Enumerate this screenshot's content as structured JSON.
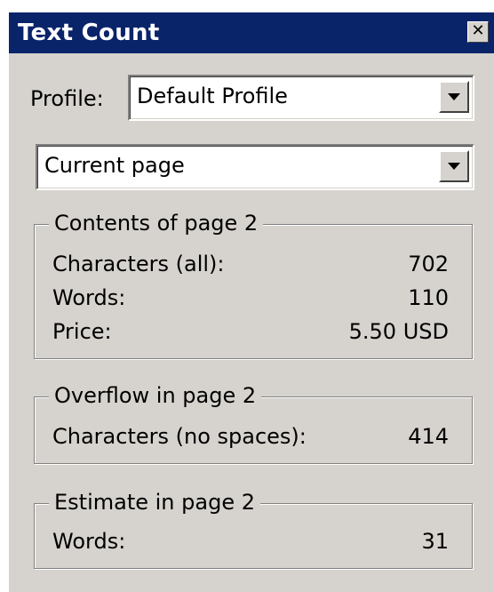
{
  "window": {
    "title": "Text Count",
    "close_glyph": "✕"
  },
  "profile": {
    "label": "Profile:",
    "selected": "Default Profile"
  },
  "scope": {
    "selected": "Current page"
  },
  "contents": {
    "legend": "Contents of page 2",
    "rows": [
      {
        "label": "Characters (all):",
        "value": "702"
      },
      {
        "label": "Words:",
        "value": "110"
      },
      {
        "label": "Price:",
        "value": "5.50 USD"
      }
    ]
  },
  "overflow": {
    "legend": "Overflow in page 2",
    "rows": [
      {
        "label": "Characters (no spaces):",
        "value": "414"
      }
    ]
  },
  "estimate": {
    "legend": "Estimate in page 2",
    "rows": [
      {
        "label": "Words:",
        "value": "31"
      }
    ]
  },
  "colors": {
    "titlebar": "#0a246a",
    "panel": "#d6d3ce"
  }
}
